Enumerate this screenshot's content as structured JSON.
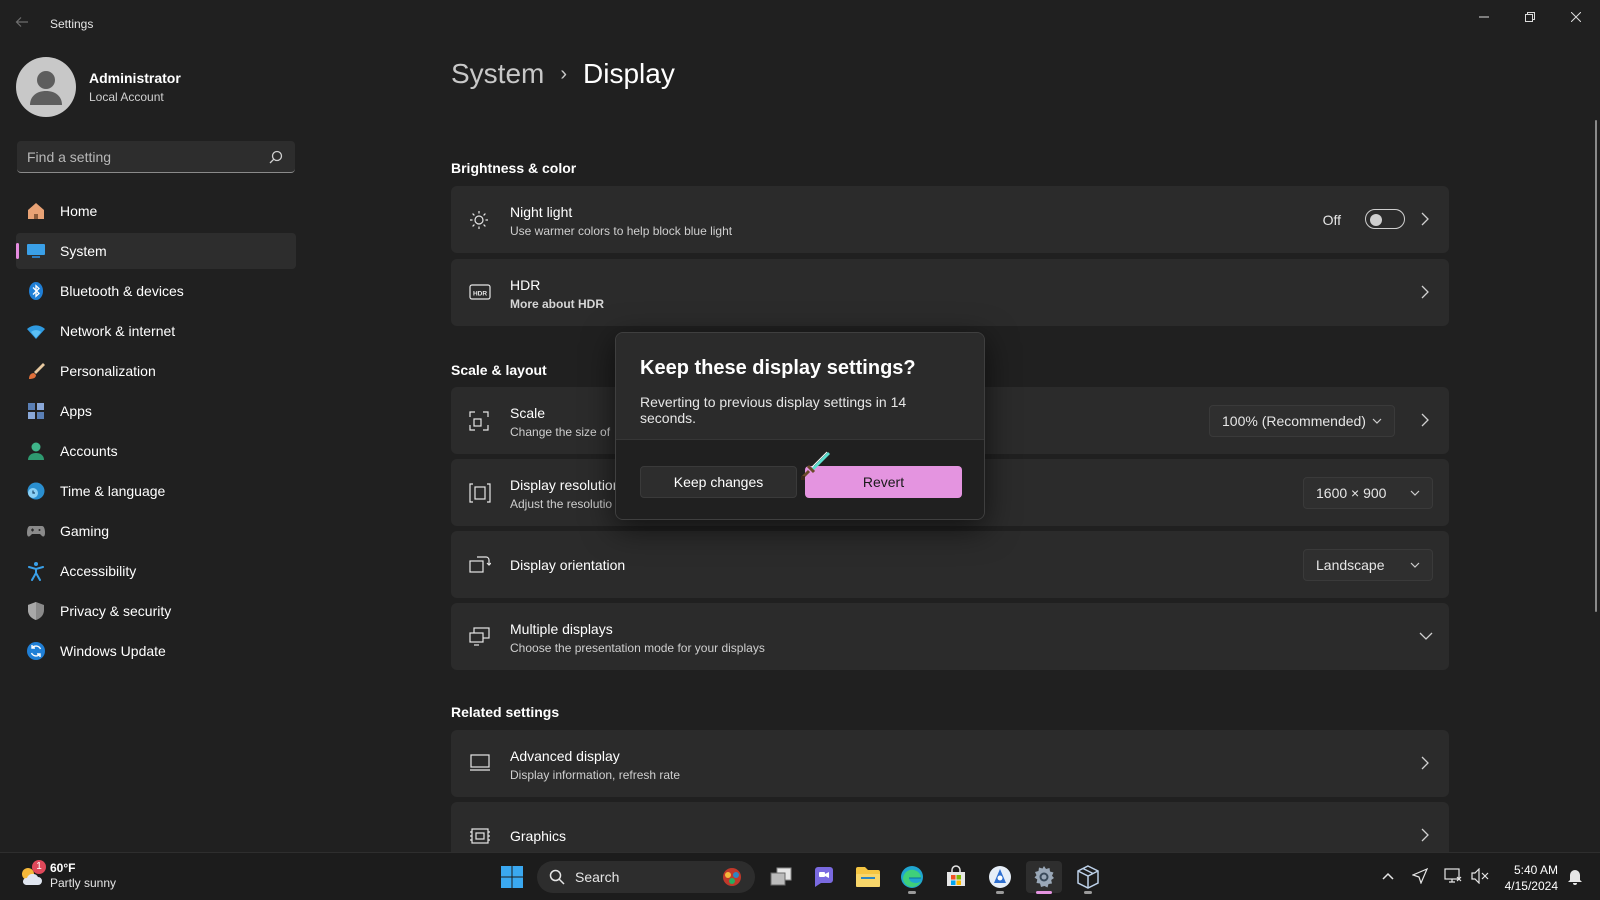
{
  "window": {
    "title": "Settings"
  },
  "profile": {
    "name": "Administrator",
    "account_type": "Local Account"
  },
  "search": {
    "placeholder": "Find a setting"
  },
  "sidebar": {
    "items": [
      {
        "label": "Home",
        "icon": "home-icon"
      },
      {
        "label": "System",
        "icon": "system-icon",
        "active": true
      },
      {
        "label": "Bluetooth & devices",
        "icon": "bluetooth-icon"
      },
      {
        "label": "Network & internet",
        "icon": "wifi-icon"
      },
      {
        "label": "Personalization",
        "icon": "brush-icon"
      },
      {
        "label": "Apps",
        "icon": "apps-icon"
      },
      {
        "label": "Accounts",
        "icon": "person-icon"
      },
      {
        "label": "Time & language",
        "icon": "globe-clock-icon"
      },
      {
        "label": "Gaming",
        "icon": "gamepad-icon"
      },
      {
        "label": "Accessibility",
        "icon": "accessibility-icon"
      },
      {
        "label": "Privacy & security",
        "icon": "shield-icon"
      },
      {
        "label": "Windows Update",
        "icon": "update-icon"
      }
    ]
  },
  "breadcrumb": {
    "parent": "System",
    "separator": "›",
    "current": "Display"
  },
  "sections": {
    "brightness": "Brightness & color",
    "scale_layout": "Scale & layout",
    "related": "Related settings"
  },
  "cards": {
    "night_light": {
      "title": "Night light",
      "subtitle": "Use warmer colors to help block blue light",
      "state_label": "Off",
      "enabled": false
    },
    "hdr": {
      "title": "HDR",
      "subtitle": "More about HDR"
    },
    "scale": {
      "title": "Scale",
      "subtitle": "Change the size of",
      "value": "100% (Recommended)"
    },
    "resolution": {
      "title": "Display resolution",
      "subtitle": "Adjust the resolutio",
      "value": "1600 × 900"
    },
    "orientation": {
      "title": "Display orientation",
      "value": "Landscape"
    },
    "multiple": {
      "title": "Multiple displays",
      "subtitle": "Choose the presentation mode for your displays"
    },
    "advanced": {
      "title": "Advanced display",
      "subtitle": "Display information, refresh rate"
    },
    "graphics": {
      "title": "Graphics"
    }
  },
  "dialog": {
    "title": "Keep these display settings?",
    "message": "Reverting to previous display settings in 14 seconds.",
    "keep_label": "Keep changes",
    "revert_label": "Revert"
  },
  "taskbar": {
    "weather_temp": "60°F",
    "weather_desc": "Partly sunny",
    "weather_badge": "1",
    "search_label": "Search",
    "time": "5:40 AM",
    "date": "4/15/2024"
  },
  "colors": {
    "accent": "#e494e0",
    "background": "#202020",
    "card": "#2b2b2b",
    "taskbar": "#1c1c1c"
  }
}
